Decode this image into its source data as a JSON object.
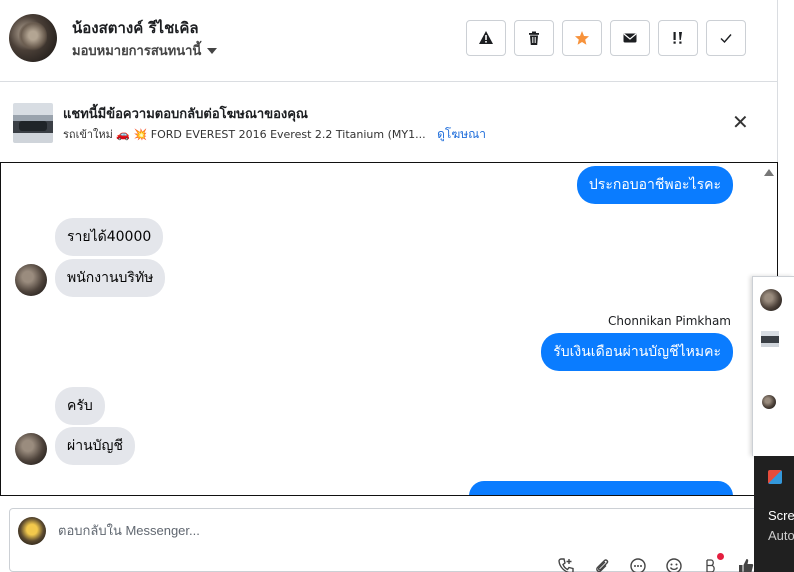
{
  "header": {
    "contact_name": "น้องสตางค์ รีไชเคิล",
    "assign_label": "มอบหมายการสนทนานี้",
    "actions": [
      {
        "name": "report-button",
        "glyph": "⚠"
      },
      {
        "name": "delete-button",
        "glyph": "🗑"
      },
      {
        "name": "star-button",
        "glyph": "★"
      },
      {
        "name": "mark-unread-button",
        "glyph": "✉"
      },
      {
        "name": "follow-up-button",
        "glyph": "!!"
      },
      {
        "name": "mark-done-button",
        "glyph": "✓"
      }
    ]
  },
  "ad_banner": {
    "title": "แชทนี้มีข้อความตอบกลับต่อโฆษณาของคุณ",
    "subtitle": "รถเข้าใหม่ 🚗 💥 FORD EVEREST 2016 Everest 2.2 Titanium (MY1...",
    "link": "ดูโฆษณา",
    "close_glyph": "✕"
  },
  "messages": [
    {
      "dir": "out",
      "text": "ประกอบอาชีพอะไรคะ"
    },
    {
      "dir": "in",
      "text": "รายได้40000"
    },
    {
      "dir": "in",
      "text": "พนักงานบริทัษ"
    },
    {
      "dir": "out",
      "sender": "Chonnikan Pimkham",
      "text": "รับเงินเดือนผ่านบัญชีไหมคะ"
    },
    {
      "dir": "in",
      "text": "ครับ"
    },
    {
      "dir": "in",
      "text": "ผ่านบัญชี"
    }
  ],
  "composer": {
    "placeholder": "ตอบกลับใน Messenger..."
  },
  "toast": {
    "line1": "Scre",
    "line2": "Auto"
  },
  "colors": {
    "outgoing_bubble": "#0a7cff",
    "incoming_bubble": "#e4e6eb",
    "star": "#f7923b",
    "link": "#216fdb",
    "notification_dot": "#e41e3f"
  }
}
